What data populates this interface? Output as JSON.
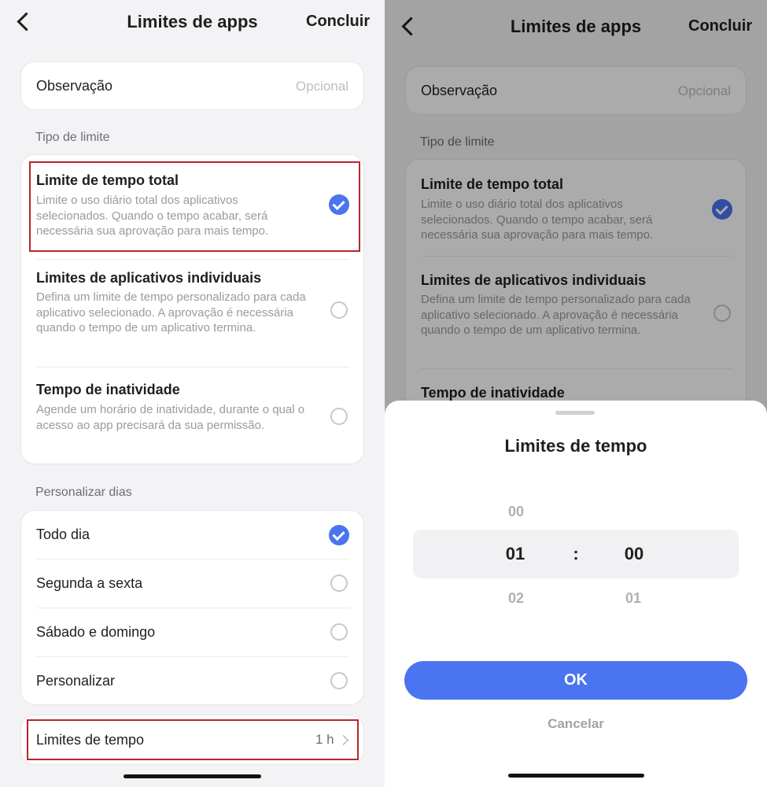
{
  "header": {
    "title": "Limites de apps",
    "done_label": "Concluir"
  },
  "note": {
    "label": "Observação",
    "placeholder": "Opcional"
  },
  "limit_type": {
    "section_label": "Tipo de limite",
    "options": [
      {
        "title": "Limite de tempo total",
        "desc": "Limite o uso diário total dos aplicativos selecionados. Quando o tempo acabar, será necessária sua aprovação para mais tempo.",
        "selected": true
      },
      {
        "title": "Limites de aplicativos individuais",
        "desc": "Defina um limite de tempo personalizado para cada aplicativo selecionado. A aprovação é necessária quando o tempo de um aplicativo termina.",
        "selected": false
      },
      {
        "title": "Tempo de inatividade",
        "desc": "Agende um horário de inatividade, durante o qual o acesso ao app precisará da sua permissão.",
        "selected": false
      }
    ]
  },
  "days": {
    "section_label": "Personalizar dias",
    "options": [
      {
        "label": "Todo dia",
        "selected": true
      },
      {
        "label": "Segunda a sexta",
        "selected": false
      },
      {
        "label": "Sábado e domingo",
        "selected": false
      },
      {
        "label": "Personalizar",
        "selected": false
      }
    ]
  },
  "time_limit": {
    "label": "Limites de tempo",
    "value": "1 h"
  },
  "picker_sheet": {
    "title": "Limites de tempo",
    "hours": {
      "prev": "00",
      "current": "01",
      "next": "02"
    },
    "separator": ":",
    "minutes": {
      "current": "00",
      "next": "01"
    },
    "ok_label": "OK",
    "cancel_label": "Cancelar"
  },
  "colors": {
    "accent": "#4a74f0",
    "highlight": "#b3282d",
    "background": "#f3f3f5"
  },
  "icons": {
    "back": "chevron-left-icon",
    "selected": "check-circle-icon",
    "unselected": "radio-empty-icon",
    "more": "chevron-right-icon"
  }
}
